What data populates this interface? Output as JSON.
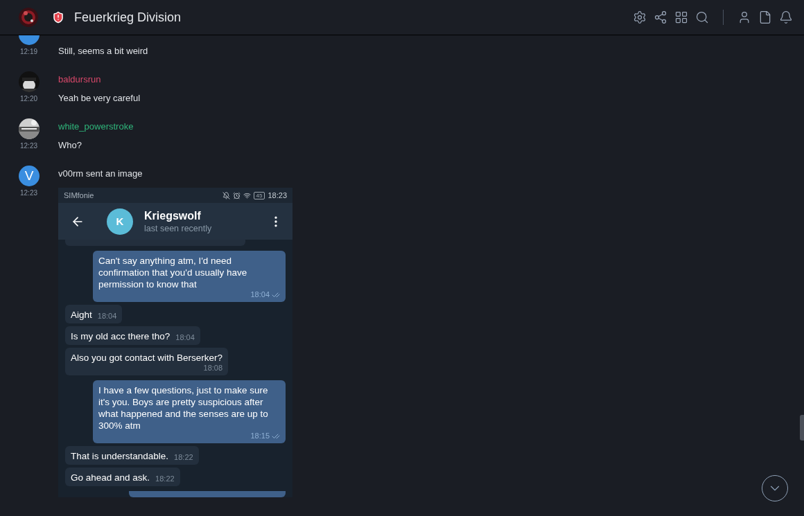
{
  "header": {
    "title": "Feuerkrieg Division"
  },
  "messages": [
    {
      "kind": "text",
      "avatar": {
        "kind": "letter"
      },
      "time": "12:19",
      "text": "Still, seems a bit weird"
    },
    {
      "kind": "text",
      "author": "baldursrun",
      "color": "#d9486a",
      "time": "12:20",
      "text": "Yeah be very careful"
    },
    {
      "kind": "text",
      "author": "white_powerstroke",
      "color": "#2fb57a",
      "time": "12:23",
      "text": "Who?"
    },
    {
      "avatar": {
        "kind": "letter",
        "letter": "V"
      },
      "author": "v00rm sent an image",
      "color": "#dfe2e6",
      "time": "12:23",
      "image": {
        "status_bar": {
          "carrier": "SIMfonie",
          "battery": "45",
          "time": "18:23"
        },
        "chat": {
          "avatar_letter": "K",
          "title": "Kriegswolf",
          "status": "last seen recently"
        },
        "bubbles": [
          {
            "outgoing": false
          },
          {
            "outgoing": true,
            "text": "Can't say anything atm, I'd need confirmation that you'd usually have permission to know that",
            "time": "18:04",
            "read": true
          },
          {
            "outgoing": false,
            "text": "Aight",
            "time": "18:04"
          },
          {
            "outgoing": false,
            "text": "Is my old acc there tho?",
            "time": "18:04"
          },
          {
            "outgoing": false,
            "text": "Also you got contact with Berserker?",
            "time": "18:08",
            "time_below": true
          },
          {
            "outgoing": true,
            "text": "I have a few questions, just to make sure it's you. Boys are pretty suspicious after what happened and the senses are up to 300% atm",
            "time": "18:15",
            "read": true
          },
          {
            "outgoing": false,
            "text": "That is understandable.",
            "time": "18:22"
          },
          {
            "outgoing": false,
            "text": "Go ahead and ask.",
            "time": "18:22"
          },
          {
            "outgoing": true
          }
        ]
      }
    }
  ]
}
